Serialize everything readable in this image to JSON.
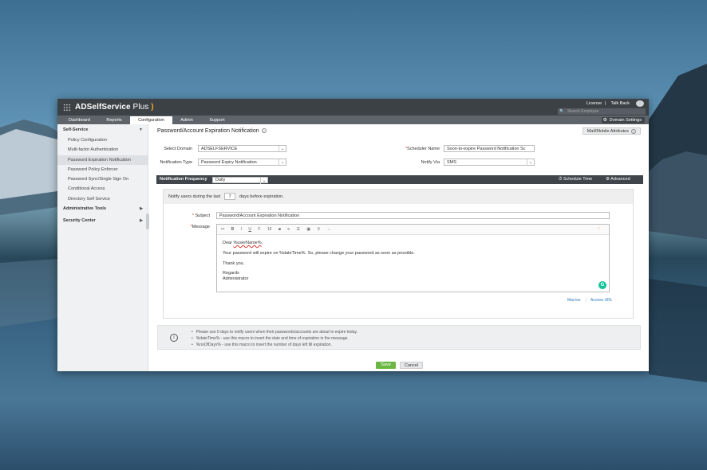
{
  "app": {
    "brand": "ADSelfService Plus",
    "brand_main": "ADSelfService",
    "brand_plus": " Plus",
    "top_links": [
      "License",
      "Talk Back"
    ],
    "search_placeholder": "Search Employee",
    "domain_settings": "Domain Settings"
  },
  "nav": {
    "tabs": [
      "Dashboard",
      "Reports",
      "Configuration",
      "Admin",
      "Support"
    ],
    "active": "Configuration"
  },
  "sidebar": {
    "section_self_service": "Self-Service",
    "items": [
      "Policy Configuration",
      "Multi-factor Authentication",
      "Password Expiration Notification",
      "Password Policy Enforcer",
      "Password Sync/Single Sign On",
      "Conditional Access",
      "Directory Self Service"
    ],
    "active_item": "Password Expiration Notification",
    "section_admin_tools": "Administrative Tools",
    "section_security": "Security Center"
  },
  "page": {
    "title": "Password/Account Expiration Notification",
    "mail_mobile_btn": "Mail/Mobile Attributes",
    "select_domain_label": "Select Domain",
    "select_domain_value": "ADSELFSERVICE",
    "notification_type_label": "Notification Type",
    "notification_type_value": "Password Expiry Notification",
    "scheduler_name_label": "Scheduler Name",
    "scheduler_name_value": "Soon-to-expire Password Notification Sc",
    "notify_via_label": "Notify Via",
    "notify_via_value": "SMS"
  },
  "frequency": {
    "label": "Notification Frequency",
    "value": "Daily",
    "schedule_time": "Schedule Time",
    "advanced": "Advanced"
  },
  "notify": {
    "prefix": "Notify users during the last",
    "days": "7",
    "suffix": "days before expiration."
  },
  "message": {
    "subject_label": "Subject",
    "subject_value": "Password/Account Expiration Notification",
    "message_label": "Message",
    "greeting_pre": "Dear ",
    "greeting_var": "%userName%",
    "greeting_post": ",",
    "line1": "Your password will expire on %dateTime%. So, please change your password as soon as possible.",
    "line2": "Thank you.",
    "line3": "Regards",
    "line4": "Administrator",
    "macros": "Macros",
    "access_url": "Access URL",
    "font_size": "10"
  },
  "info": [
    "Please use 0 days to notify users when their passwords/accounts are about to expire today.",
    "%dateTime% - use this macro to insert the date and time of expiration in the message.",
    "%noOfDays% - use this macro to insert the number of days left till expiration."
  ],
  "actions": {
    "save": "Save",
    "cancel": "Cancel"
  },
  "colors": {
    "header": "#3c4146",
    "navbar": "#5e646a",
    "save": "#6cb743",
    "link": "#2a7ab8"
  }
}
